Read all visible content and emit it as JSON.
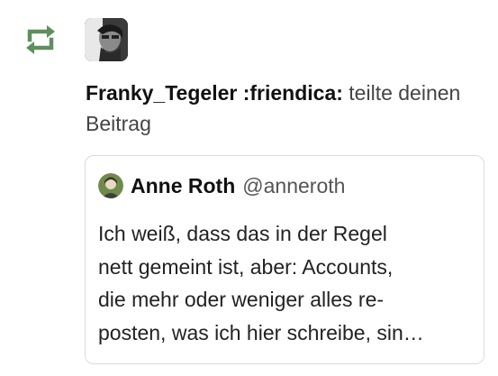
{
  "notification": {
    "icon": "boost-icon",
    "icon_color": "#5e8f5e",
    "actor": "Franky_Tegeler :friendica:",
    "action": "teilte deinen Beitrag"
  },
  "status_card": {
    "author_name": "Anne Roth",
    "author_handle": "@anneroth",
    "text_lines": [
      "Ich weiß, dass das in der Regel",
      "nett gemeint ist, aber: Accounts,",
      "die mehr oder weniger alles re-",
      "posten, was ich hier schreibe, sin…"
    ]
  }
}
